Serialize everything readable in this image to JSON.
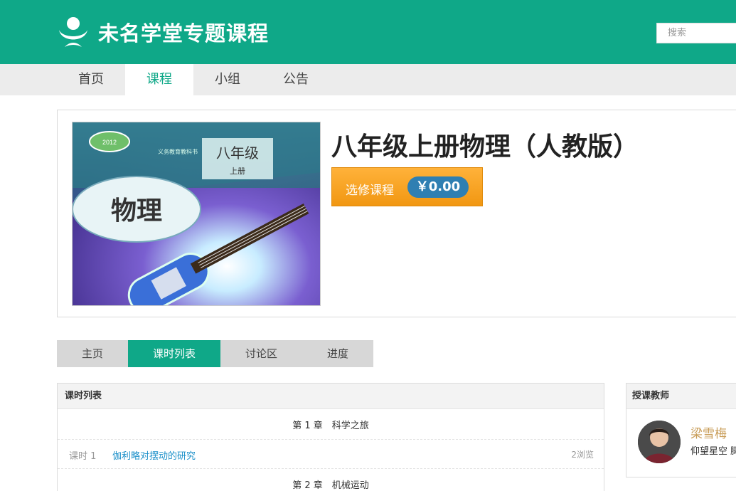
{
  "header": {
    "site_title": "未名学堂专题课程",
    "search_placeholder": "搜索"
  },
  "nav": {
    "items": [
      {
        "label": "首页"
      },
      {
        "label": "课程",
        "active": true
      },
      {
        "label": "小组"
      },
      {
        "label": "公告"
      }
    ]
  },
  "course": {
    "title": "八年级上册物理（人教版）",
    "enroll_label": "选修课程",
    "price": "￥0.00",
    "cover": {
      "grade": "八年级",
      "volume": "上册",
      "subject": "物理",
      "series": "义务教育教科书"
    }
  },
  "tabs": [
    {
      "label": "主页"
    },
    {
      "label": "课时列表",
      "active": true
    },
    {
      "label": "讨论区"
    },
    {
      "label": "进度"
    }
  ],
  "lessons": {
    "heading": "课时列表",
    "chapter1": "第 1 章　科学之旅",
    "lesson1": {
      "number": "课时 1",
      "title": "伽利略对摆动的研究",
      "views": "2浏览"
    },
    "chapter2": "第 2 章　机械运动"
  },
  "teacher": {
    "heading": "授课教师",
    "name": "梁雪梅",
    "bio": "仰望星空 脚"
  },
  "colors": {
    "brand": "#0fa888",
    "enroll": "#f4a020",
    "price_pill": "#2f7fb2",
    "link": "#1a8fc9",
    "teacher_name": "#c89c57"
  }
}
